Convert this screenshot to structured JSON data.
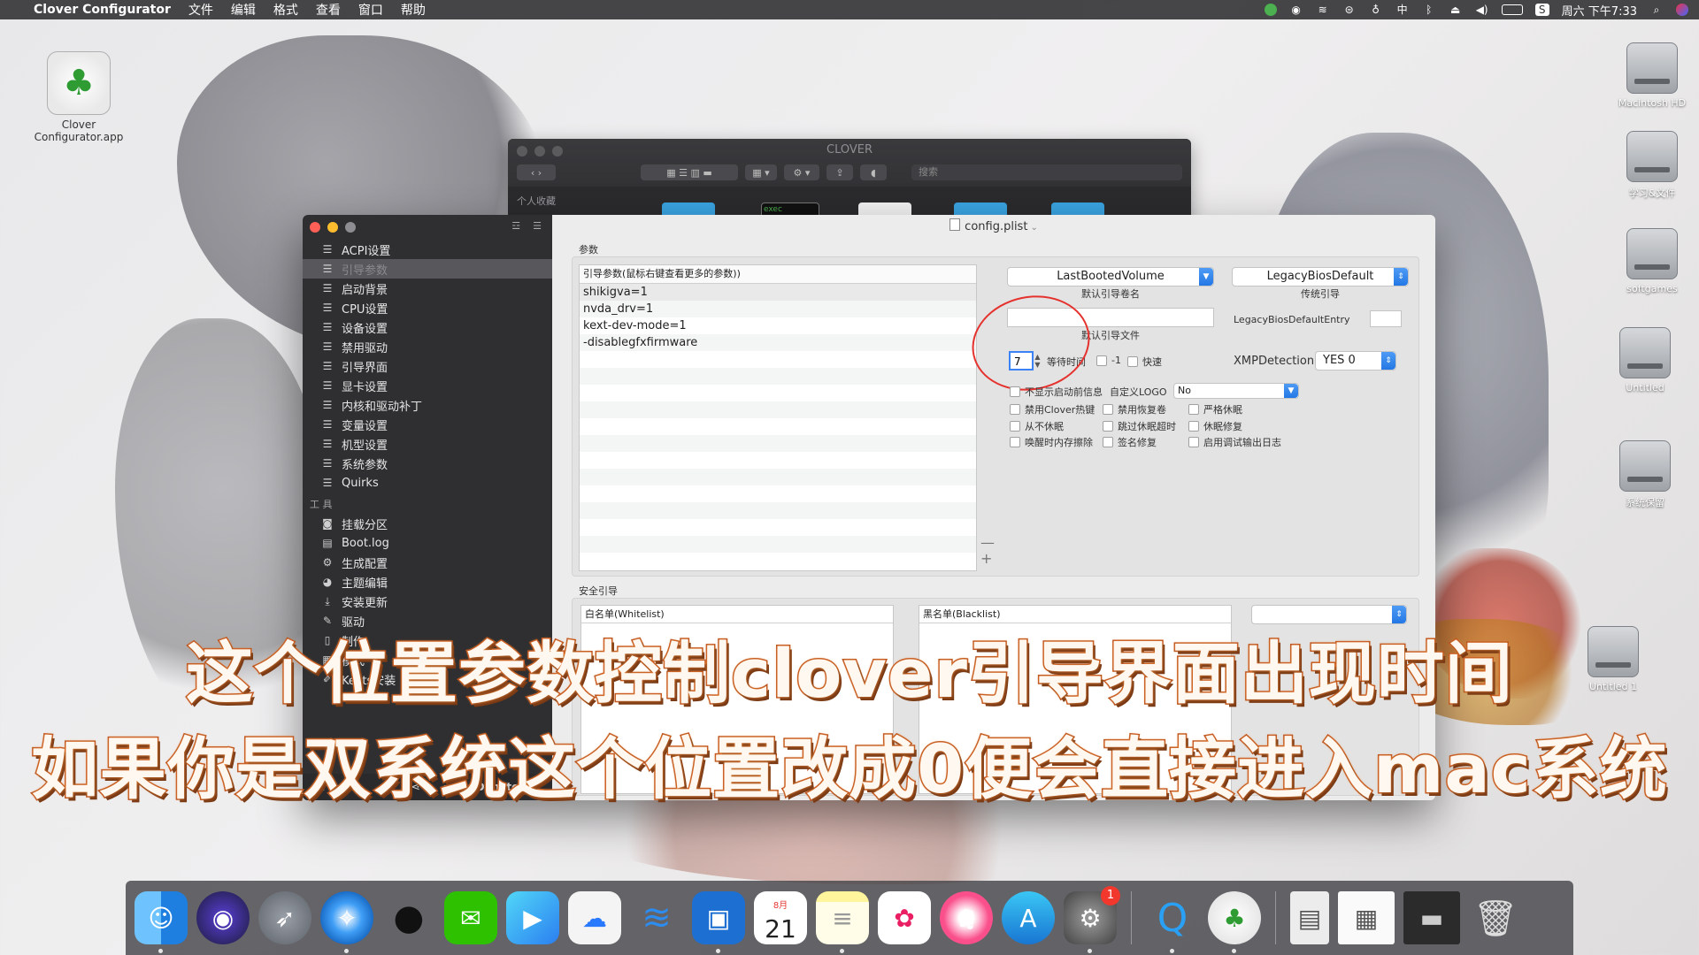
{
  "menubar": {
    "app_name": "Clover Configurator",
    "menus": [
      "文件",
      "编辑",
      "格式",
      "查看",
      "窗口",
      "帮助"
    ],
    "clock": "周六 下午7:33",
    "tray_icons": [
      "wechat-tray-icon",
      "record-icon",
      "wifi-icon",
      "vpn-icon",
      "mic-icon",
      "input-method-icon",
      "bluetooth-icon",
      "eject-icon",
      "volume-icon",
      "battery-icon",
      "control-icon",
      "search-icon",
      "siri-icon"
    ],
    "input_method_label": "中"
  },
  "desktop": {
    "app_icon_label": "Clover Configurator.app",
    "disks": [
      {
        "label": "Macintosh HD"
      },
      {
        "label": "学习&文件"
      },
      {
        "label": "softgames"
      },
      {
        "label": "Untitled"
      },
      {
        "label": "系统保留"
      },
      {
        "label": "Untitled 1"
      }
    ]
  },
  "finder": {
    "title": "CLOVER",
    "search_placeholder": "搜索",
    "sidebar_header": "个人收藏",
    "exec_label": "exec"
  },
  "clover": {
    "document_title": "config.plist",
    "sidebar_items": [
      {
        "label": "ACPI设置",
        "icon": "list-icon"
      },
      {
        "label": "引导参数",
        "icon": "list-icon",
        "selected": true
      },
      {
        "label": "启动背景",
        "icon": "list-icon"
      },
      {
        "label": "CPU设置",
        "icon": "list-icon"
      },
      {
        "label": "设备设置",
        "icon": "list-icon"
      },
      {
        "label": "禁用驱动",
        "icon": "list-icon"
      },
      {
        "label": "引导界面",
        "icon": "list-icon"
      },
      {
        "label": "显卡设置",
        "icon": "list-icon"
      },
      {
        "label": "内核和驱动补丁",
        "icon": "list-icon"
      },
      {
        "label": "变量设置",
        "icon": "list-icon"
      },
      {
        "label": "机型设置",
        "icon": "list-icon"
      },
      {
        "label": "系统参数",
        "icon": "list-icon"
      },
      {
        "label": "Quirks",
        "icon": "list-icon"
      }
    ],
    "tools_header": "工 具",
    "tools_items": [
      {
        "label": "挂载分区",
        "icon": "disk-icon"
      },
      {
        "label": "Boot.log",
        "icon": "log-icon"
      },
      {
        "label": "生成配置",
        "icon": "gears-icon"
      },
      {
        "label": "主题编辑",
        "icon": "palette-icon"
      },
      {
        "label": "安装更新",
        "icon": "download-icon"
      },
      {
        "label": "驱动",
        "icon": "wrench-icon"
      },
      {
        "label": "制作",
        "icon": "usb-icon"
      },
      {
        "label": "模式",
        "icon": "mode-icon"
      },
      {
        "label": "Kexts安装",
        "icon": "brush-icon"
      }
    ],
    "footer": {
      "donate": "Donate",
      "paypal": "Pay Pal"
    },
    "params_group_label": "参数",
    "boot_args": {
      "header": "引导参数(鼠标右键查看更多的参数))",
      "rows": [
        "shikigva=1",
        "nvda_drv=1",
        "kext-dev-mode=1",
        "-disablegfxfirmware"
      ]
    },
    "default_volume": {
      "value": "LastBootedVolume",
      "label": "默认引导卷名"
    },
    "legacy": {
      "value": "LegacyBiosDefault",
      "label": "传统引导"
    },
    "default_loader": {
      "value": "",
      "label": "默认引导文件"
    },
    "legacy_entry": {
      "label": "LegacyBiosDefaultEntry",
      "value": ""
    },
    "timeout": {
      "value": "7",
      "label": "等待时间"
    },
    "minus_one_label": "-1",
    "fast_label": "快速",
    "xmp": {
      "label": "XMPDetection",
      "value": "YES 0"
    },
    "no_early_progress_label": "不显示启动前信息",
    "custom_logo": {
      "label": "自定义LOGO",
      "value": "No"
    },
    "checkboxes": [
      [
        "禁用Clover热键",
        "禁用恢复卷",
        "严格休眠"
      ],
      [
        "从不休眠",
        "跳过休眠超时",
        "休眠修复"
      ],
      [
        "唤醒时内存擦除",
        "签名修复",
        "启用调试输出日志"
      ]
    ],
    "secure_group_label": "安全引导",
    "whitelist_header": "白名单(Whitelist)",
    "blacklist_header": "黑名单(Blacklist)",
    "secure_popup_value": ""
  },
  "subtitles": {
    "line1": "这个位置参数控制clover引导界面出现时间",
    "line2": "如果你是双系统这个位置改成0便会直接进入mac系统"
  },
  "dock": {
    "calendar_month": "8月",
    "calendar_day": "21",
    "settings_badge": "1",
    "icons": [
      {
        "name": "finder-icon",
        "glyph": "☺",
        "color": "#2c8ef5"
      },
      {
        "name": "siri-icon",
        "glyph": "◉",
        "color": "#2a2a4a"
      },
      {
        "name": "launchpad-icon",
        "glyph": "🚀",
        "color": "#7c7c84"
      },
      {
        "name": "safari-icon",
        "glyph": "◎",
        "color": "#1e88e5"
      },
      {
        "name": "qq-icon",
        "glyph": "🐧",
        "color": "#f0f0f0"
      },
      {
        "name": "wechat-icon",
        "glyph": "💬",
        "color": "#2dc100"
      },
      {
        "name": "video-player-icon",
        "glyph": "▶",
        "color": "#38a0f0"
      },
      {
        "name": "baidu-netdisk-icon",
        "glyph": "☁",
        "color": "#f5f5f5"
      },
      {
        "name": "wifi-tool-icon",
        "glyph": "≋",
        "color": "#1976d2"
      },
      {
        "name": "screen-recorder-icon",
        "glyph": "▣",
        "color": "#1b6fc9"
      }
    ]
  }
}
